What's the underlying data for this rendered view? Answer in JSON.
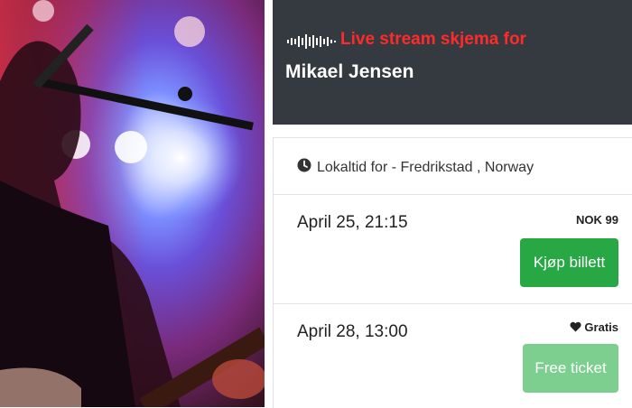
{
  "header": {
    "live_label": "Live stream skjema for",
    "artist_name": "Mikael Jensen",
    "wave_icon": "audio-wave-icon",
    "accent_color": "#ff2a2a",
    "background_color": "#353a40"
  },
  "timezone": {
    "icon": "clock-icon",
    "label": "Lokaltid for - Fredrikstad , Norway"
  },
  "events": [
    {
      "date": "April 25, 21:15",
      "price": "NOK 99",
      "button_label": "Kjøp billett",
      "button_color": "#28a745"
    },
    {
      "date": "April 28, 13:00",
      "price": "Gratis",
      "price_icon": "heart-icon",
      "button_label": "Free ticket",
      "button_color": "#7ccf8f"
    }
  ]
}
